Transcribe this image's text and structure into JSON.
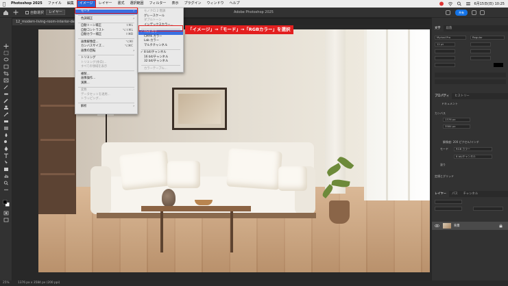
{
  "menubar": {
    "app": "Photoshop 2025",
    "items": [
      "ファイル",
      "編集",
      "イメージ",
      "レイヤー",
      "書式",
      "選択範囲",
      "フィルター",
      "表示",
      "プラグイン",
      "ウィンドウ",
      "ヘルプ"
    ],
    "datetime": "6月15日(日) 10:25"
  },
  "optbar": {
    "autoselect_label": "自動選択",
    "autoselect_target": "レイヤー",
    "doc_title": "Adobe Photoshop 2025",
    "share_label": "共有"
  },
  "doctab": {
    "label": "12_modern-living-room-interior-design.jpg"
  },
  "callout": {
    "text": "「イメージ」→「モード」→「RGBカラー」を選択"
  },
  "image_menu": {
    "items": [
      {
        "label": "モード",
        "submenu": true,
        "hl": true
      },
      {
        "label": "色調補正",
        "submenu": true
      },
      {
        "label": "自動トーン補正",
        "shortcut": "⇧⌘L"
      },
      {
        "label": "自動コントラスト",
        "shortcut": "⌥⇧⌘L"
      },
      {
        "label": "自動カラー補正",
        "shortcut": "⇧⌘B"
      },
      {
        "label": "画像解像度...",
        "shortcut": "⌥⌘I"
      },
      {
        "label": "カンバスサイズ...",
        "shortcut": "⌥⌘C"
      },
      {
        "label": "画像の回転",
        "submenu": true
      },
      {
        "label": "トリミング"
      },
      {
        "label": "トリミング(余白)...",
        "dis": true
      },
      {
        "label": "すべての領域を表示",
        "dis": true
      },
      {
        "label": "複製..."
      },
      {
        "label": "画像操作..."
      },
      {
        "label": "演算..."
      },
      {
        "label": "変数",
        "submenu": true,
        "dis": true
      },
      {
        "label": "データセットを適用...",
        "dis": true
      },
      {
        "label": "トラッピング...",
        "dis": true
      },
      {
        "label": "解析",
        "submenu": true
      }
    ]
  },
  "mode_menu": {
    "items": [
      {
        "label": "モノクロ 2 階調",
        "dis": true
      },
      {
        "label": "グレースケール"
      },
      {
        "label": "ダブルトーン",
        "dis": true
      },
      {
        "label": "インデックスカラー..."
      },
      {
        "label": "RGB カラー",
        "checked": true,
        "hl": true
      },
      {
        "label": "CMYK カラー"
      },
      {
        "label": "Lab カラー"
      },
      {
        "label": "マルチチャンネル"
      },
      {
        "label": "8 bit/チャンネル",
        "checked": true
      },
      {
        "label": "16 bit/チャンネル"
      },
      {
        "label": "32 bit/チャンネル"
      },
      {
        "label": "カラーテーブル...",
        "dis": true
      }
    ]
  },
  "panels": {
    "char_tabs": [
      "文字",
      "段落"
    ],
    "font": "Myriad Pro",
    "style": "Regular",
    "size": "12 pt",
    "props_tabs": [
      "プロパティ",
      "ヒストリー"
    ],
    "doc_label": "ドキュメント",
    "canvas_label": "カンバス",
    "w_value": "1376 px",
    "h_value": "3584 px",
    "resolution": "解像度: 200 ピクセル/インチ",
    "mode_label": "モード",
    "mode_value": "RGB カラー",
    "bit_value": "8 bit/チャンネル",
    "bg_label": "塗り",
    "guides_label": "定規とグリッド",
    "layer_tabs": [
      "レイヤー",
      "パス",
      "チャンネル"
    ],
    "layer_name": "背景"
  },
  "statusbar": {
    "zoom": "25%",
    "info": "1376 px x 3584 px (200 ppi)"
  },
  "colors": {
    "accent": "#e31f1f",
    "highlight": "#3a6fe0"
  }
}
